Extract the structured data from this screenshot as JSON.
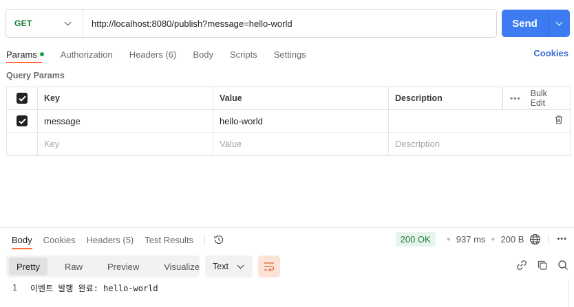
{
  "request": {
    "method": "GET",
    "url": "http://localhost:8080/publish?message=hello-world",
    "send_label": "Send"
  },
  "request_tabs": [
    {
      "label": "Params",
      "active": true,
      "has_dot": true
    },
    {
      "label": "Authorization"
    },
    {
      "label": "Headers (6)"
    },
    {
      "label": "Body"
    },
    {
      "label": "Scripts"
    },
    {
      "label": "Settings"
    }
  ],
  "cookies_label": "Cookies",
  "query_params": {
    "title": "Query Params",
    "headers": {
      "key": "Key",
      "value": "Value",
      "description": "Description",
      "bulk_edit": "Bulk Edit",
      "bulk_dots": "•••"
    },
    "rows": [
      {
        "key": "message",
        "value": "hello-world",
        "description": "",
        "checked": true
      }
    ],
    "placeholder": {
      "key": "Key",
      "value": "Value",
      "description": "Description"
    }
  },
  "response": {
    "tabs": [
      {
        "label": "Body",
        "active": true
      },
      {
        "label": "Cookies"
      },
      {
        "label": "Headers (5)"
      },
      {
        "label": "Test Results"
      }
    ],
    "status": "200 OK",
    "time": "937 ms",
    "size": "200 B",
    "more": "•••",
    "formats": [
      {
        "label": "Pretty",
        "active": true
      },
      {
        "label": "Raw"
      },
      {
        "label": "Preview"
      },
      {
        "label": "Visualize"
      }
    ],
    "language": "Text",
    "lines": [
      {
        "no": "1",
        "text": "이벤트 발행 완료: hello-world"
      }
    ]
  },
  "colors": {
    "accent": "#ff6c37",
    "send": "#3d7cf0",
    "method_get": "#0b7d2e",
    "status_ok": "#1c7a3d"
  }
}
